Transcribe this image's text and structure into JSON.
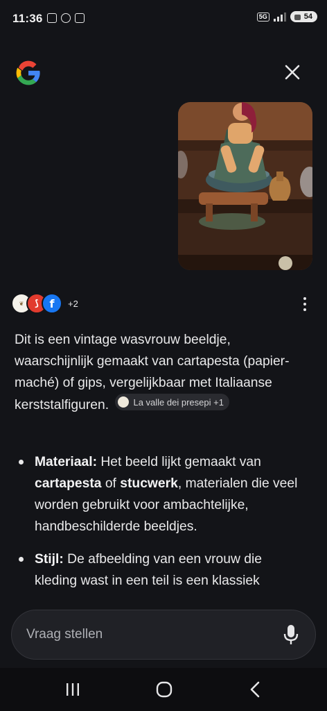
{
  "status_bar": {
    "time": "11:36",
    "network": "5G",
    "battery": "54"
  },
  "header": {
    "logo_icon": "google-g-logo",
    "close_icon": "close-icon"
  },
  "image_query": {
    "description_icon": "uploaded-photo"
  },
  "sources": {
    "more_count": "+2"
  },
  "answer": {
    "paragraph": "Dit is een vintage wasvrouw beeldje, waarschijnlijk gemaakt van cartapesta (papier-maché) of gips, vergelijkbaar met Italiaanse kerststalfiguren.",
    "chip_label": "La valle dei presepi +1",
    "bullets": [
      {
        "label": "Materiaal:",
        "text_1": " Het beeld lijkt gemaakt van ",
        "bold_1": "cartapesta",
        "text_2": " of ",
        "bold_2": "stucwerk",
        "text_3": ", materialen die veel worden gebruikt voor ambachtelijke, handbeschilderde beeldjes."
      },
      {
        "label": "Stijl:",
        "text_1": " De afbeelding van een vrouw die kleding wast in een teil is een klassiek"
      }
    ]
  },
  "ask_bar": {
    "placeholder": "Vraag stellen",
    "mic_icon": "microphone-icon"
  },
  "nav_bar": {
    "recents_icon": "recents-icon",
    "home_icon": "home-icon",
    "back_icon": "back-icon"
  },
  "colors": {
    "background": "#131418",
    "text": "#e9e9ea",
    "chip_bg": "#2a2b30",
    "ask_bar_bg": "#202126"
  }
}
